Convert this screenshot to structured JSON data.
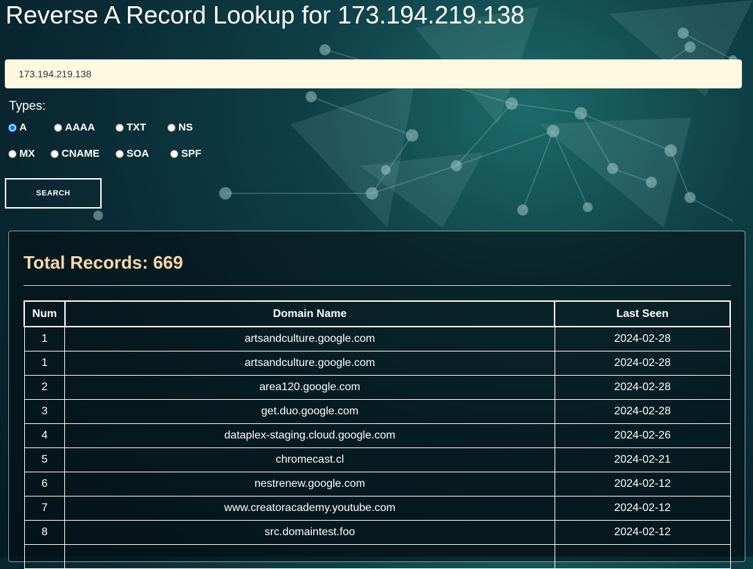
{
  "page": {
    "title": "Reverse A Record Lookup for 173.194.219.138"
  },
  "search": {
    "value": "173.194.219.138",
    "types_label": "Types:",
    "types": [
      {
        "label": "A",
        "checked": true
      },
      {
        "label": "AAAA",
        "checked": false
      },
      {
        "label": "TXT",
        "checked": false
      },
      {
        "label": "NS",
        "checked": false
      },
      {
        "label": "MX",
        "checked": false
      },
      {
        "label": "CNAME",
        "checked": false
      },
      {
        "label": "SOA",
        "checked": false
      },
      {
        "label": "SPF",
        "checked": false
      }
    ],
    "button_label": "SEARCH"
  },
  "results": {
    "total_label": "Total Records: 669",
    "columns": [
      "Num",
      "Domain Name",
      "Last Seen"
    ],
    "rows": [
      {
        "num": "1",
        "domain": "artsandculture.google.com",
        "last_seen": "2024-02-28"
      },
      {
        "num": "1",
        "domain": "artsandculture.google.com",
        "last_seen": "2024-02-28"
      },
      {
        "num": "2",
        "domain": "area120.google.com",
        "last_seen": "2024-02-28"
      },
      {
        "num": "3",
        "domain": "get.duo.google.com",
        "last_seen": "2024-02-28"
      },
      {
        "num": "4",
        "domain": "dataplex-staging.cloud.google.com",
        "last_seen": "2024-02-26"
      },
      {
        "num": "5",
        "domain": "chromecast.cl",
        "last_seen": "2024-02-21"
      },
      {
        "num": "6",
        "domain": "nestrenew.google.com",
        "last_seen": "2024-02-12"
      },
      {
        "num": "7",
        "domain": "www.creatoracademy.youtube.com",
        "last_seen": "2024-02-12"
      },
      {
        "num": "8",
        "domain": "src.domaintest.foo",
        "last_seen": "2024-02-12"
      }
    ]
  },
  "colors": {
    "background": "#0a2a34",
    "input_background": "#fef9e0",
    "total_text": "#f5d8a8"
  }
}
